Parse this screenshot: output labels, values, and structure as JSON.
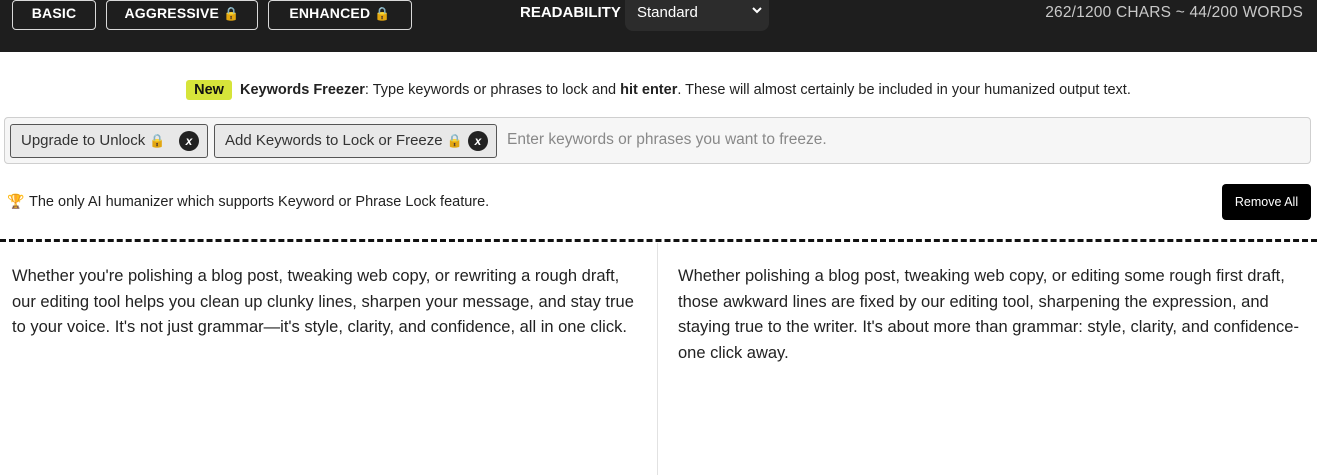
{
  "topbar": {
    "modes": [
      {
        "label": "BASIC",
        "locked": false
      },
      {
        "label": "AGGRESSIVE",
        "locked": true
      },
      {
        "label": "ENHANCED",
        "locked": true
      }
    ],
    "lock_glyph": "🔒",
    "readability_label": "READABILITY",
    "readability_value": "Standard",
    "counter": "262/1200 CHARS ~ 44/200 WORDS"
  },
  "notice": {
    "badge": "New",
    "title": "Keywords Freezer",
    "text_before": ": Type keywords or phrases to lock and ",
    "emphasis": "hit enter",
    "text_after": ". These will almost certainly be included in your humanized output text."
  },
  "keywords": {
    "chips": [
      {
        "label": "Upgrade to Unlock"
      },
      {
        "label": "Add Keywords to Lock or Freeze"
      }
    ],
    "remove_glyph": "x",
    "placeholder": "Enter keywords or phrases you want to freeze."
  },
  "feature": {
    "text": "The only AI humanizer which supports Keyword or Phrase Lock feature.",
    "trophy_glyph": "🏆",
    "remove_all": "Remove All"
  },
  "panels": {
    "input_text": "Whether you're polishing a blog post, tweaking web copy, or rewriting a rough draft, our editing tool helps you clean up clunky lines, sharpen your message, and stay true to your voice. It's not just grammar—it's style, clarity, and confidence, all in one click.",
    "output_text": "Whether polishing a blog post, tweaking web copy, or editing some rough first draft, those awkward lines are fixed by our editing tool, sharpening the expression, and staying true to the writer. It's about more than grammar: style, clarity, and confidence-one click away."
  }
}
